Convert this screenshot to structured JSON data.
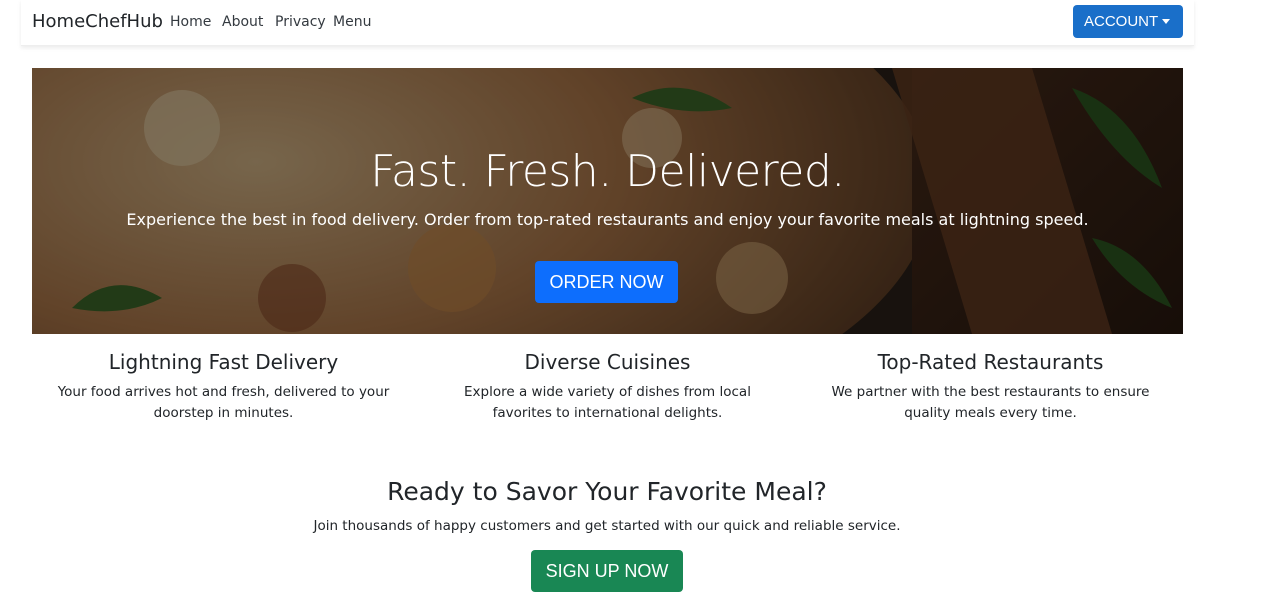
{
  "navbar": {
    "brand": "HomeChefHub",
    "links": [
      "Home",
      "About",
      "Privacy",
      "Menu"
    ],
    "account_label": "ACCOUNT"
  },
  "hero": {
    "title": "Fast. Fresh. Delivered.",
    "subtitle": "Experience the best in food delivery. Order from top-rated restaurants and enjoy your favorite meals at lightning speed.",
    "cta_label": "ORDER NOW"
  },
  "features": [
    {
      "title": "Lightning Fast Delivery",
      "description": "Your food arrives hot and fresh, delivered to your doorstep in minutes."
    },
    {
      "title": "Diverse Cuisines",
      "description": "Explore a wide variety of dishes from local favorites to international delights."
    },
    {
      "title": "Top-Rated Restaurants",
      "description": "We partner with the best restaurants to ensure quality meals every time."
    }
  ],
  "cta": {
    "title": "Ready to Savor Your Favorite Meal?",
    "subtitle": "Join thousands of happy customers and get started with our quick and reliable service.",
    "button_label": "SIGN UP NOW"
  },
  "colors": {
    "account_button": "#1a6fc9",
    "order_button": "#0d6efd",
    "signup_button": "#198754",
    "text": "#212529"
  },
  "icons": {
    "account_dropdown": "caret-down-icon"
  }
}
